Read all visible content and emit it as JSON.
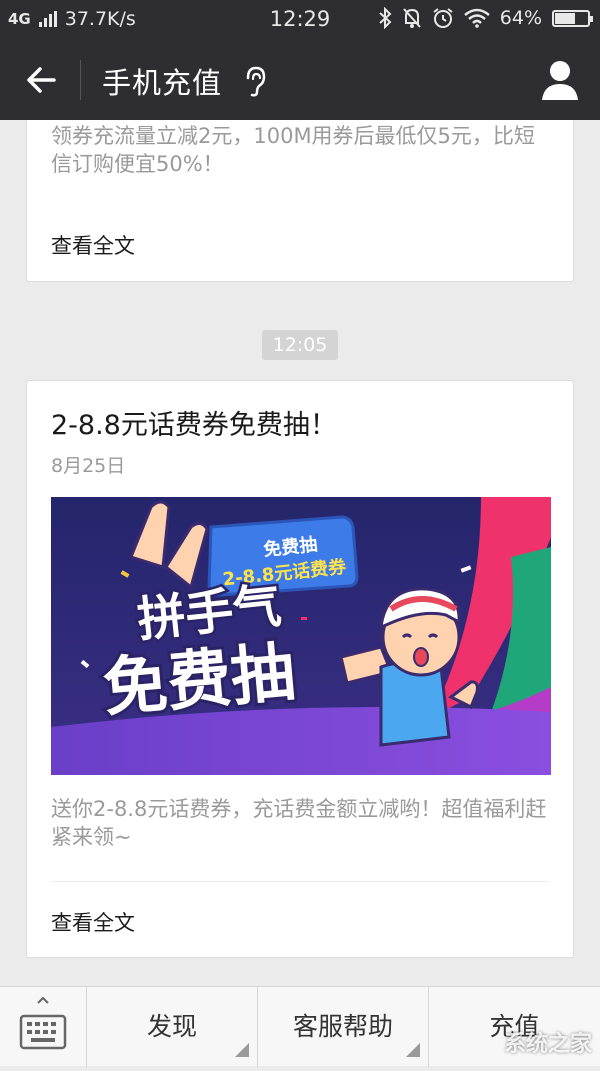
{
  "status_bar": {
    "network": "4G",
    "speed": "37.7K/s",
    "time": "12:29",
    "battery": "64%",
    "battery_level": 0.64
  },
  "header": {
    "title": "手机充值"
  },
  "articles": [
    {
      "description": "领券充流量立减2元，100M用券后最低仅5元，比短信订购便宜50%！",
      "read_more": "查看全文"
    },
    {
      "time_chip": "12:05",
      "title": "2-8.8元话费券免费抽！",
      "date": "8月25日",
      "banner": {
        "tag_line1": "免费抽",
        "tag_line2": "2-8.8元话费券",
        "headline1": "拼手气",
        "headline2": "免费抽"
      },
      "description": "送你2-8.8元话费券，充话费金额立减哟！超值福利赶紧来领~",
      "read_more": "查看全文"
    }
  ],
  "bottom_bar": {
    "tabs": [
      "发现",
      "客服帮助",
      "充值"
    ]
  },
  "watermark": "系统之家",
  "colors": {
    "bar_bg": "#2e2e32",
    "page_bg": "#ebebeb",
    "banner_bg": "#2f2d7a",
    "accent_pink": "#f0326c",
    "accent_green": "#1fa77a"
  }
}
